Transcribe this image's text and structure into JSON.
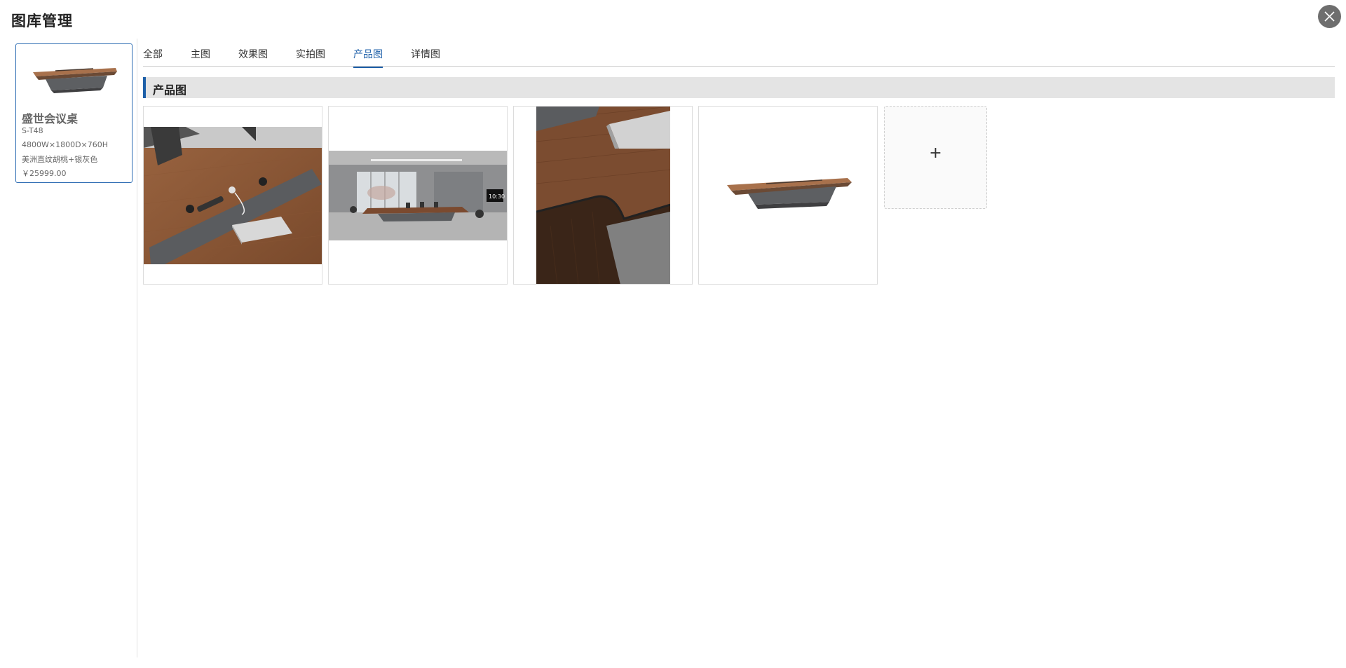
{
  "dialog": {
    "title": "图库管理",
    "close_icon": "close-icon"
  },
  "product": {
    "name": "盛世会议桌",
    "code": "S-T48",
    "size": "4800W×1800D×760H",
    "material": "美洲直纹胡桃+银灰色",
    "price": "￥25999.00"
  },
  "tabs": [
    {
      "label": "全部"
    },
    {
      "label": "主图"
    },
    {
      "label": "效果图"
    },
    {
      "label": "实拍图"
    },
    {
      "label": "产品图",
      "active": true
    },
    {
      "label": "详情图"
    }
  ],
  "section": {
    "title": "产品图"
  },
  "images": [
    {
      "name": "desk-closeup-cable-port"
    },
    {
      "name": "meeting-room-scene"
    },
    {
      "name": "desk-edge-detail"
    },
    {
      "name": "desk-product-white"
    }
  ],
  "upload": {
    "symbol": "+"
  },
  "colors": {
    "accent": "#1d5fa8",
    "walnut": "#8a5a3c",
    "section_bg": "#e4e4e4"
  }
}
